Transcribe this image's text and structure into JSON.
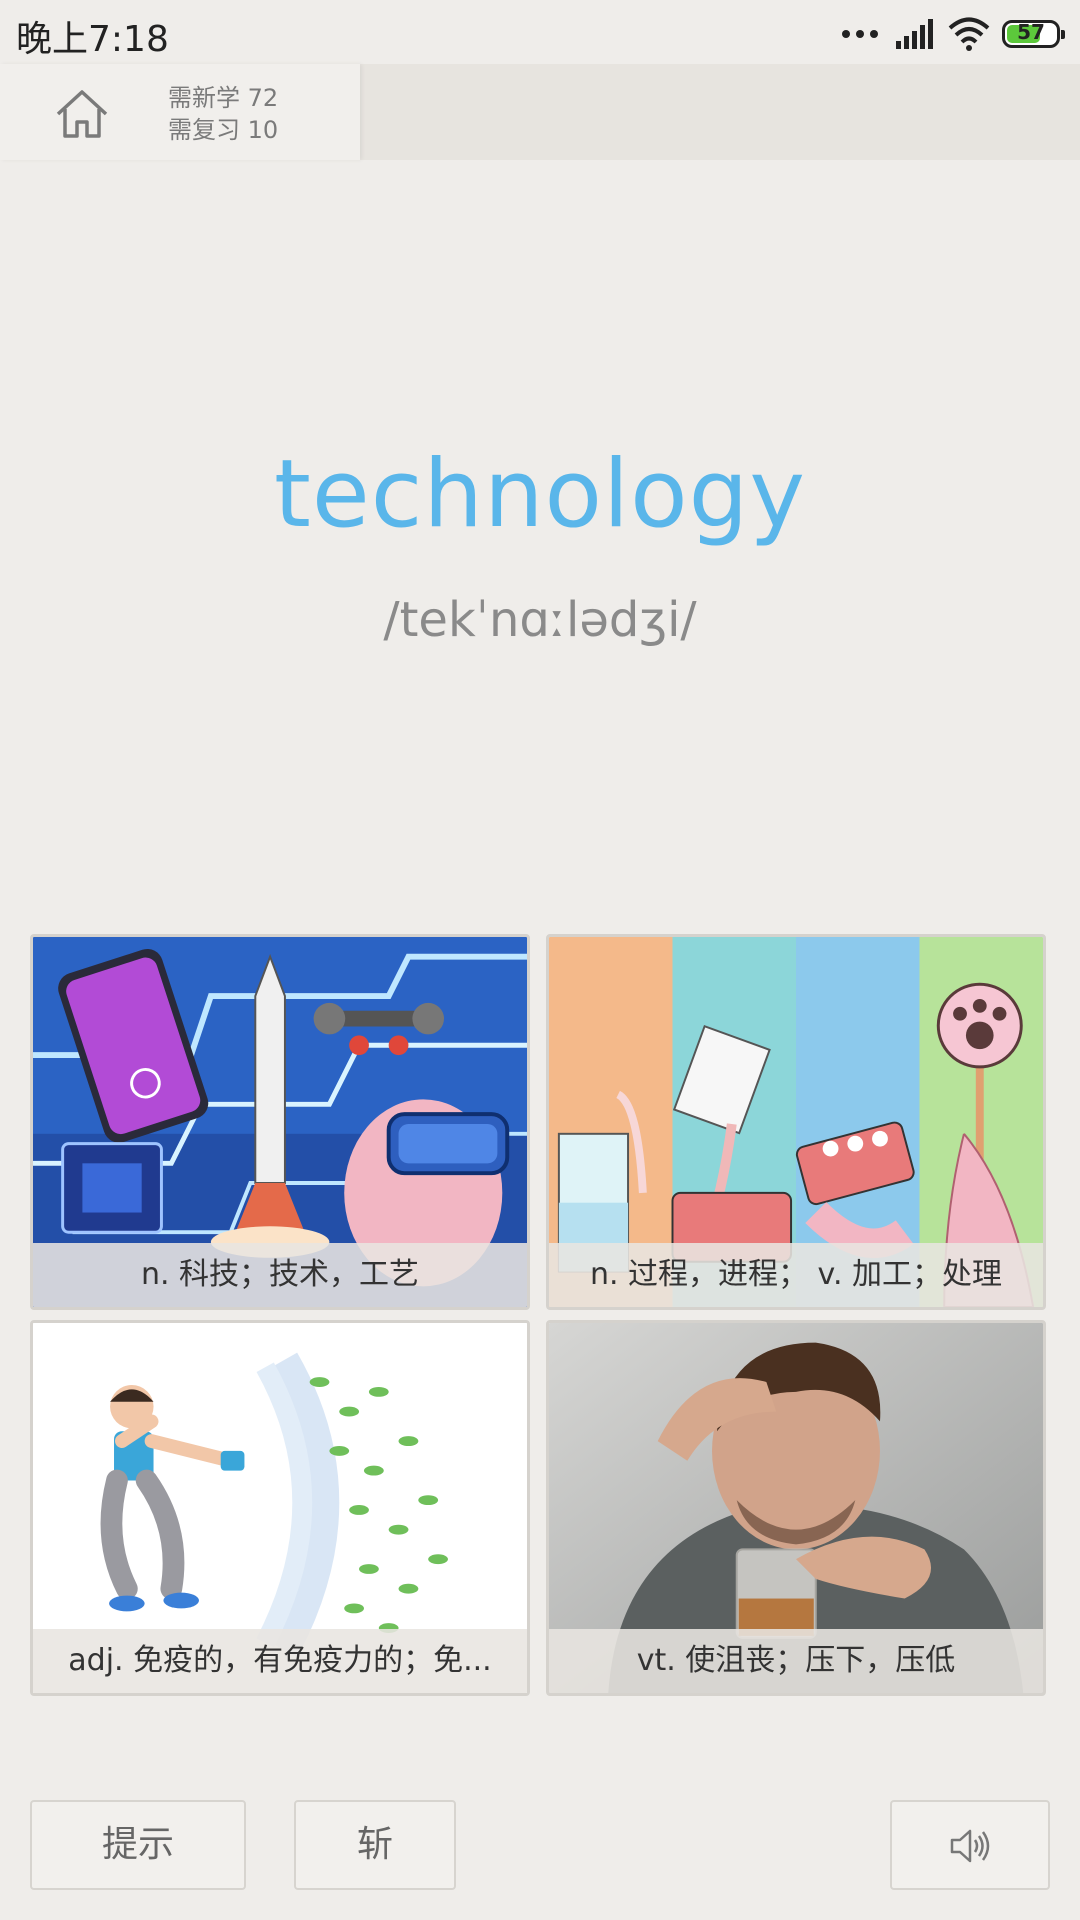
{
  "status_bar": {
    "time": "晚上7:18",
    "battery": "57"
  },
  "header": {
    "new_to_learn": "需新学 72",
    "to_review": "需复习 10"
  },
  "word": {
    "text": "technology",
    "phonetic": "/tekˈnɑːlədʒi/"
  },
  "options": [
    {
      "caption": "n. 科技；技术，工艺",
      "image": "technology-collage-illustration"
    },
    {
      "caption": "n. 过程，进程；  v. 加工；处理",
      "image": "process-steps-illustration"
    },
    {
      "caption": "adj. 免疫的，有免疫力的；免...",
      "image": "immune-shield-illustration"
    },
    {
      "caption": "vt. 使沮丧；压下，压低",
      "image": "depressed-man-photo"
    }
  ],
  "buttons": {
    "hint": "提示",
    "cut": "斩",
    "sound_icon": "speaker-icon"
  },
  "colors": {
    "accent_word": "#5ab6ea",
    "background": "#efedea"
  }
}
